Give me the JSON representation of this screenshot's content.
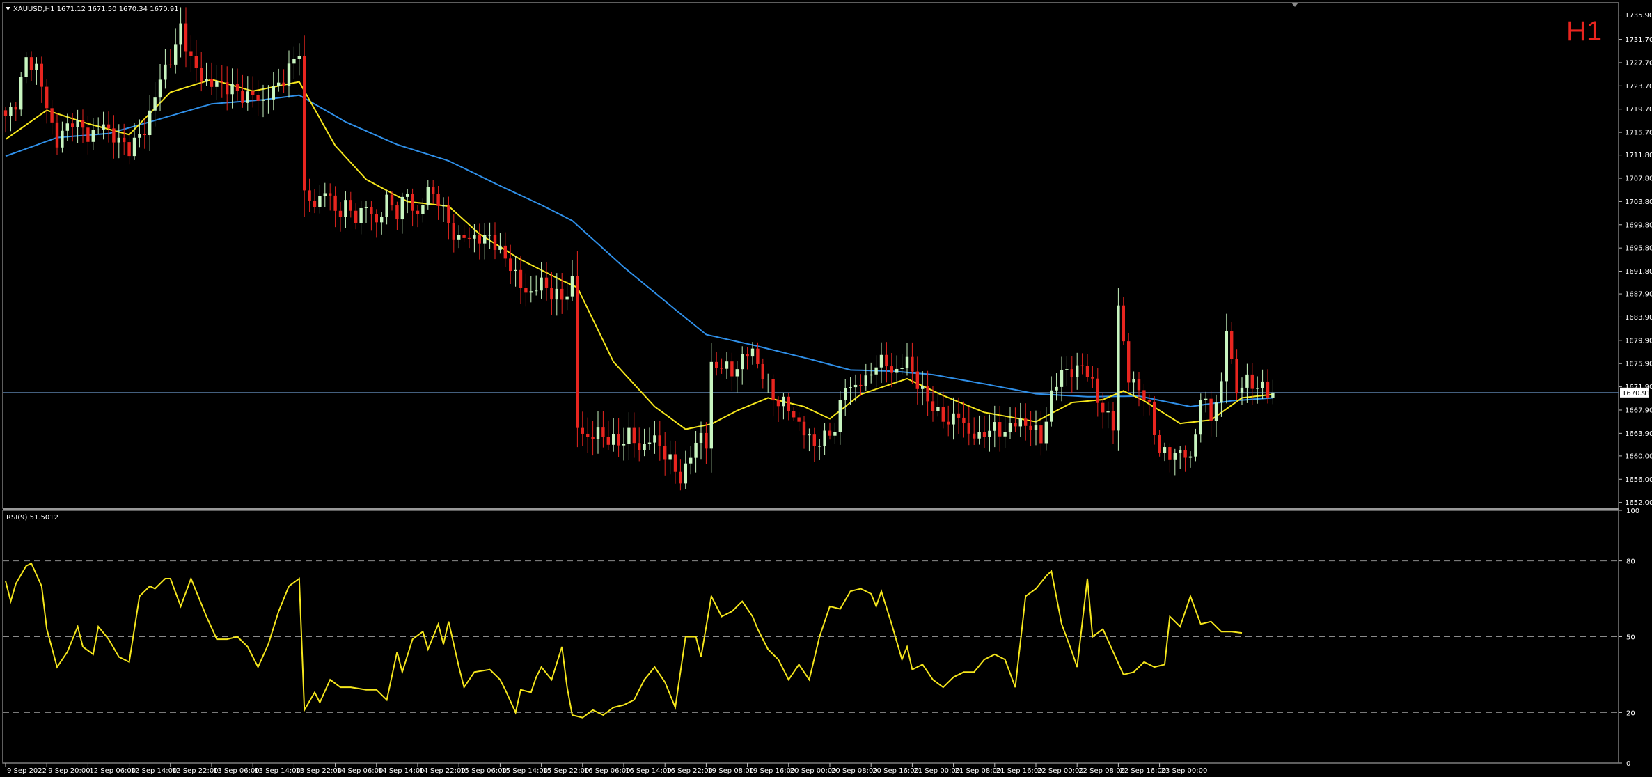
{
  "header": {
    "symbol_info": "XAUUSD,H1  1671.12 1671.50 1670.34 1670.91",
    "timeframe": "H1",
    "current_price_label": "1670.91"
  },
  "rsi": {
    "label": "RSI(9) 51.5012",
    "levels": [
      80,
      50,
      20
    ],
    "axis_labels": [
      "100",
      "80",
      "50",
      "20",
      "0"
    ]
  },
  "colors": {
    "bull": "#c8f5c0",
    "bear": "#e8251f",
    "ma_fast": "#f5e61c",
    "ma_slow": "#2f8fe8",
    "rsi_line": "#f5e61c",
    "price_line": "#5b7fa8",
    "grid": "#8a8a8a"
  },
  "chart_data": [
    {
      "type": "candlestick",
      "symbol": "XAUUSD",
      "timeframe": "H1",
      "y_ticks": [
        "1735.90",
        "1731.70",
        "1727.70",
        "1723.70",
        "1719.70",
        "1715.70",
        "1711.80",
        "1707.80",
        "1703.80",
        "1699.80",
        "1695.80",
        "1691.80",
        "1687.90",
        "1683.90",
        "1679.90",
        "1675.90",
        "1671.90",
        "1667.90",
        "1663.90",
        "1660.00",
        "1656.00",
        "1652.00"
      ],
      "ylim": [
        1651,
        1738
      ],
      "x_labels": [
        "9 Sep 2022",
        "9 Sep 20:00",
        "12 Sep 06:00",
        "12 Sep 14:00",
        "12 Sep 22:00",
        "13 Sep 06:00",
        "13 Sep 14:00",
        "13 Sep 22:00",
        "14 Sep 06:00",
        "14 Sep 14:00",
        "14 Sep 22:00",
        "15 Sep 06:00",
        "15 Sep 14:00",
        "15 Sep 22:00",
        "16 Sep 06:00",
        "16 Sep 14:00",
        "16 Sep 22:00",
        "19 Sep 08:00",
        "19 Sep 16:00",
        "20 Sep 00:00",
        "20 Sep 08:00",
        "20 Sep 16:00",
        "21 Sep 00:00",
        "21 Sep 08:00",
        "21 Sep 16:00",
        "22 Sep 00:00",
        "22 Sep 08:00",
        "22 Sep 16:00",
        "23 Sep 00:00"
      ],
      "current_price": 1670.91,
      "close_anchors": [
        [
          0,
          1718
        ],
        [
          2,
          1721
        ],
        [
          4,
          1728
        ],
        [
          6,
          1727
        ],
        [
          8,
          1720
        ],
        [
          10,
          1714
        ],
        [
          13,
          1718
        ],
        [
          16,
          1715
        ],
        [
          19,
          1717
        ],
        [
          22,
          1714
        ],
        [
          24,
          1713
        ],
        [
          27,
          1716
        ],
        [
          29,
          1722
        ],
        [
          31,
          1727
        ],
        [
          33,
          1730
        ],
        [
          34,
          1734
        ],
        [
          36,
          1728
        ],
        [
          38,
          1725
        ],
        [
          40,
          1724
        ],
        [
          42,
          1724
        ],
        [
          44,
          1723
        ],
        [
          46,
          1722
        ],
        [
          48,
          1722
        ],
        [
          50,
          1721
        ],
        [
          52,
          1723
        ],
        [
          54,
          1725
        ],
        [
          56,
          1728
        ],
        [
          57,
          1730
        ],
        [
          58,
          1705
        ],
        [
          60,
          1703
        ],
        [
          62,
          1706
        ],
        [
          64,
          1702
        ],
        [
          66,
          1703
        ],
        [
          68,
          1701
        ],
        [
          70,
          1703
        ],
        [
          72,
          1700
        ],
        [
          74,
          1704
        ],
        [
          76,
          1702
        ],
        [
          78,
          1705
        ],
        [
          80,
          1701
        ],
        [
          82,
          1706
        ],
        [
          84,
          1704
        ],
        [
          86,
          1700
        ],
        [
          88,
          1697
        ],
        [
          90,
          1698
        ],
        [
          92,
          1697
        ],
        [
          94,
          1698
        ],
        [
          96,
          1695
        ],
        [
          98,
          1693
        ],
        [
          100,
          1689
        ],
        [
          102,
          1688
        ],
        [
          104,
          1690
        ],
        [
          106,
          1688
        ],
        [
          108,
          1687
        ],
        [
          110,
          1690
        ],
        [
          111,
          1665
        ],
        [
          113,
          1663
        ],
        [
          115,
          1664
        ],
        [
          117,
          1663
        ],
        [
          119,
          1662
        ],
        [
          121,
          1664
        ],
        [
          123,
          1661
        ],
        [
          125,
          1663
        ],
        [
          127,
          1662
        ],
        [
          129,
          1659
        ],
        [
          131,
          1656
        ],
        [
          133,
          1660
        ],
        [
          135,
          1664
        ],
        [
          136,
          1662
        ],
        [
          137,
          1675
        ],
        [
          139,
          1676
        ],
        [
          141,
          1674
        ],
        [
          143,
          1677
        ],
        [
          145,
          1678
        ],
        [
          147,
          1674
        ],
        [
          149,
          1670
        ],
        [
          151,
          1669
        ],
        [
          153,
          1667
        ],
        [
          155,
          1664
        ],
        [
          157,
          1662
        ],
        [
          159,
          1663
        ],
        [
          161,
          1665
        ],
        [
          163,
          1672
        ],
        [
          165,
          1672
        ],
        [
          167,
          1673
        ],
        [
          169,
          1676
        ],
        [
          171,
          1676
        ],
        [
          173,
          1674
        ],
        [
          175,
          1677
        ],
        [
          177,
          1672
        ],
        [
          179,
          1670
        ],
        [
          181,
          1667
        ],
        [
          183,
          1666
        ],
        [
          185,
          1667
        ],
        [
          187,
          1664
        ],
        [
          189,
          1663
        ],
        [
          191,
          1665
        ],
        [
          193,
          1664
        ],
        [
          195,
          1665
        ],
        [
          197,
          1666
        ],
        [
          199,
          1665
        ],
        [
          201,
          1663
        ],
        [
          203,
          1670
        ],
        [
          205,
          1675
        ],
        [
          207,
          1674
        ],
        [
          209,
          1676
        ],
        [
          211,
          1672
        ],
        [
          213,
          1668
        ],
        [
          215,
          1665
        ],
        [
          216,
          1686
        ],
        [
          218,
          1673
        ],
        [
          220,
          1672
        ],
        [
          222,
          1668
        ],
        [
          224,
          1661
        ],
        [
          226,
          1660
        ],
        [
          228,
          1661
        ],
        [
          230,
          1659
        ],
        [
          232,
          1670
        ],
        [
          234,
          1667
        ],
        [
          236,
          1672
        ],
        [
          237,
          1682
        ],
        [
          239,
          1671
        ],
        [
          241,
          1673
        ],
        [
          243,
          1672
        ],
        [
          245,
          1671
        ],
        [
          246,
          1670.91
        ]
      ],
      "ma_fast": [
        [
          0,
          1714.5
        ],
        [
          8,
          1719.5
        ],
        [
          16,
          1717.2
        ],
        [
          24,
          1715.3
        ],
        [
          32,
          1722.6
        ],
        [
          40,
          1724.8
        ],
        [
          48,
          1722.8
        ],
        [
          57,
          1724.4
        ],
        [
          64,
          1713.4
        ],
        [
          70,
          1707.6
        ],
        [
          78,
          1703.8
        ],
        [
          86,
          1703.0
        ],
        [
          92,
          1698.2
        ],
        [
          100,
          1693.8
        ],
        [
          108,
          1690.2
        ],
        [
          111,
          1689.0
        ],
        [
          118,
          1676.2
        ],
        [
          126,
          1668.5
        ],
        [
          132,
          1664.6
        ],
        [
          137,
          1665.5
        ],
        [
          142,
          1667.8
        ],
        [
          148,
          1670.0
        ],
        [
          155,
          1668.5
        ],
        [
          160,
          1666.4
        ],
        [
          166,
          1670.6
        ],
        [
          175,
          1673.3
        ],
        [
          182,
          1670.4
        ],
        [
          190,
          1667.5
        ],
        [
          200,
          1665.9
        ],
        [
          207,
          1669.2
        ],
        [
          213,
          1669.7
        ],
        [
          217,
          1671.2
        ],
        [
          221,
          1669.5
        ],
        [
          228,
          1665.6
        ],
        [
          234,
          1666.2
        ],
        [
          240,
          1670.0
        ],
        [
          246,
          1670.6
        ]
      ],
      "ma_slow": [
        [
          0,
          1711.6
        ],
        [
          10,
          1714.8
        ],
        [
          20,
          1715.5
        ],
        [
          28,
          1717.5
        ],
        [
          40,
          1720.6
        ],
        [
          50,
          1721.3
        ],
        [
          57,
          1722.1
        ],
        [
          66,
          1717.5
        ],
        [
          76,
          1713.6
        ],
        [
          86,
          1710.8
        ],
        [
          96,
          1706.5
        ],
        [
          104,
          1703.2
        ],
        [
          110,
          1700.5
        ],
        [
          120,
          1692.5
        ],
        [
          130,
          1685.2
        ],
        [
          136,
          1680.9
        ],
        [
          146,
          1678.9
        ],
        [
          156,
          1676.7
        ],
        [
          164,
          1674.8
        ],
        [
          172,
          1674.6
        ],
        [
          180,
          1674.0
        ],
        [
          190,
          1672.4
        ],
        [
          200,
          1670.7
        ],
        [
          210,
          1670.2
        ],
        [
          220,
          1670.3
        ],
        [
          230,
          1668.5
        ],
        [
          238,
          1669.5
        ],
        [
          246,
          1670.0
        ]
      ]
    },
    {
      "type": "line",
      "title": "RSI(9) 51.5012",
      "ylim": [
        0,
        100
      ],
      "y_ticks": [
        100,
        80,
        50,
        20,
        0
      ],
      "levels": [
        80,
        50,
        20
      ],
      "values": [
        [
          0,
          72
        ],
        [
          1,
          64
        ],
        [
          2,
          71
        ],
        [
          4,
          78
        ],
        [
          5,
          79
        ],
        [
          7,
          70
        ],
        [
          8,
          53
        ],
        [
          10,
          38
        ],
        [
          12,
          44
        ],
        [
          14,
          54
        ],
        [
          15,
          46
        ],
        [
          17,
          43
        ],
        [
          18,
          54
        ],
        [
          20,
          49
        ],
        [
          22,
          42
        ],
        [
          24,
          40
        ],
        [
          26,
          66
        ],
        [
          28,
          70
        ],
        [
          29,
          69
        ],
        [
          31,
          73
        ],
        [
          32,
          73
        ],
        [
          34,
          62
        ],
        [
          36,
          73
        ],
        [
          37,
          68
        ],
        [
          39,
          58
        ],
        [
          41,
          49
        ],
        [
          43,
          49
        ],
        [
          45,
          50
        ],
        [
          47,
          46
        ],
        [
          49,
          38
        ],
        [
          51,
          47
        ],
        [
          53,
          60
        ],
        [
          55,
          70
        ],
        [
          57,
          73
        ],
        [
          58,
          21
        ],
        [
          60,
          28
        ],
        [
          61,
          24
        ],
        [
          63,
          33
        ],
        [
          65,
          30
        ],
        [
          67,
          30
        ],
        [
          70,
          29
        ],
        [
          72,
          29
        ],
        [
          74,
          25
        ],
        [
          76,
          44
        ],
        [
          77,
          36
        ],
        [
          79,
          49
        ],
        [
          81,
          52
        ],
        [
          82,
          45
        ],
        [
          84,
          55
        ],
        [
          85,
          47
        ],
        [
          86,
          56
        ],
        [
          88,
          38
        ],
        [
          89,
          30
        ],
        [
          91,
          36
        ],
        [
          94,
          37
        ],
        [
          96,
          33
        ],
        [
          97,
          29
        ],
        [
          99,
          20
        ],
        [
          100,
          29
        ],
        [
          102,
          28
        ],
        [
          103,
          34
        ],
        [
          104,
          38
        ],
        [
          106,
          33
        ],
        [
          108,
          46
        ],
        [
          109,
          30
        ],
        [
          110,
          19
        ],
        [
          112,
          18
        ],
        [
          114,
          21
        ],
        [
          116,
          19
        ],
        [
          118,
          22
        ],
        [
          120,
          23
        ],
        [
          122,
          25
        ],
        [
          124,
          33
        ],
        [
          126,
          38
        ],
        [
          128,
          32
        ],
        [
          130,
          22
        ],
        [
          132,
          50
        ],
        [
          134,
          50
        ],
        [
          135,
          42
        ],
        [
          137,
          66
        ],
        [
          139,
          58
        ],
        [
          141,
          60
        ],
        [
          143,
          64
        ],
        [
          145,
          58
        ],
        [
          146,
          53
        ],
        [
          148,
          45
        ],
        [
          150,
          41
        ],
        [
          152,
          33
        ],
        [
          154,
          39
        ],
        [
          156,
          33
        ],
        [
          158,
          50
        ],
        [
          160,
          62
        ],
        [
          162,
          61
        ],
        [
          164,
          68
        ],
        [
          166,
          69
        ],
        [
          168,
          67
        ],
        [
          169,
          62
        ],
        [
          170,
          68
        ],
        [
          172,
          55
        ],
        [
          174,
          41
        ],
        [
          175,
          46
        ],
        [
          176,
          37
        ],
        [
          178,
          39
        ],
        [
          180,
          33
        ],
        [
          182,
          30
        ],
        [
          184,
          34
        ],
        [
          186,
          36
        ],
        [
          188,
          36
        ],
        [
          190,
          41
        ],
        [
          192,
          43
        ],
        [
          194,
          41
        ],
        [
          196,
          30
        ],
        [
          198,
          66
        ],
        [
          200,
          69
        ],
        [
          202,
          74
        ],
        [
          203,
          76
        ],
        [
          205,
          55
        ],
        [
          207,
          44
        ],
        [
          208,
          38
        ],
        [
          210,
          73
        ],
        [
          211,
          50
        ],
        [
          213,
          53
        ],
        [
          215,
          44
        ],
        [
          217,
          35
        ],
        [
          219,
          36
        ],
        [
          221,
          40
        ],
        [
          223,
          38
        ],
        [
          225,
          39
        ],
        [
          226,
          58
        ],
        [
          228,
          54
        ],
        [
          230,
          66
        ],
        [
          232,
          55
        ],
        [
          234,
          56
        ],
        [
          236,
          52
        ],
        [
          238,
          52
        ],
        [
          240,
          51.5
        ]
      ]
    }
  ]
}
